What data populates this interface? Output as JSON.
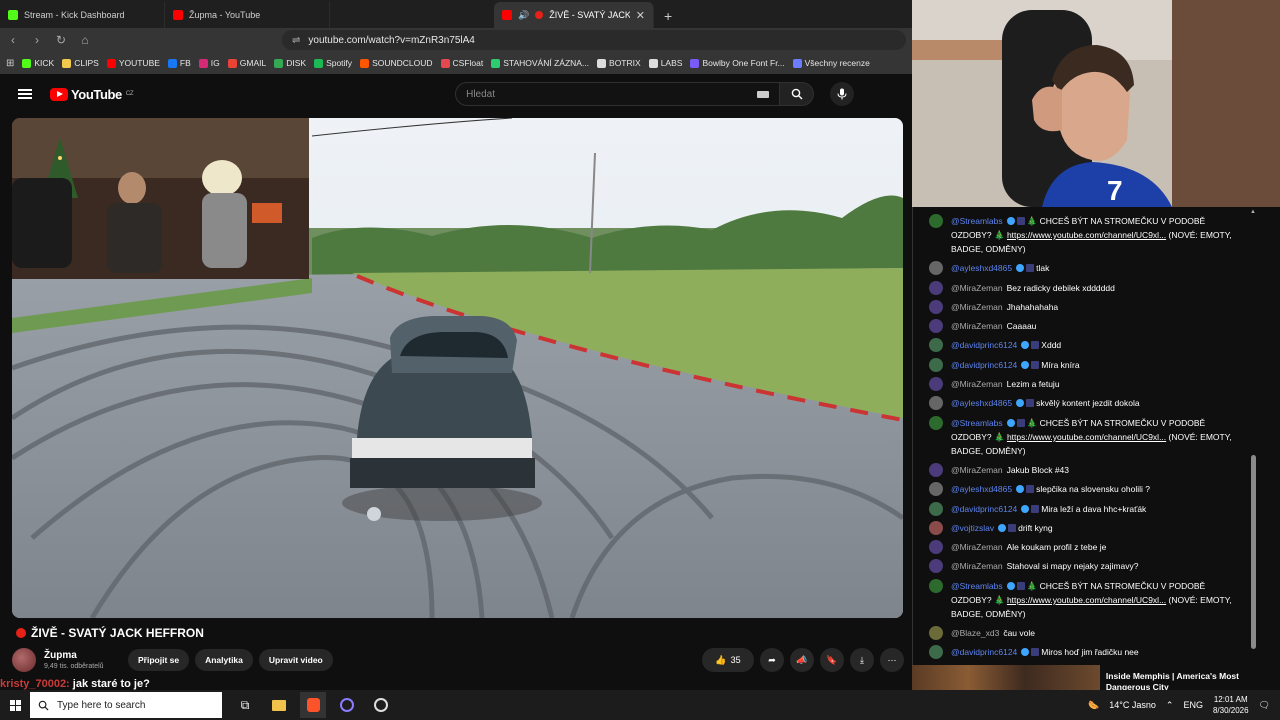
{
  "browser": {
    "tabs": [
      {
        "label": "Stream - Kick Dashboard",
        "color": "#53fc18"
      },
      {
        "label": "Župma - YouTube",
        "color": "#ff0000"
      },
      {
        "label": "ŽIVĚ - SVATÝ JACK HEFFRO",
        "color": "#ff0000"
      }
    ],
    "url": "youtube.com/watch?v=mZnR3n75lA4",
    "bookmarks": [
      {
        "label": "KICK",
        "color": "#53fc18"
      },
      {
        "label": "CLIPS",
        "color": "#f2c94c"
      },
      {
        "label": "YOUTUBE",
        "color": "#ff0000"
      },
      {
        "label": "FB",
        "color": "#1877f2"
      },
      {
        "label": "IG",
        "color": "#d62976"
      },
      {
        "label": "GMAIL",
        "color": "#ea4335"
      },
      {
        "label": "DISK",
        "color": "#34a853"
      },
      {
        "label": "Spotify",
        "color": "#1db954"
      },
      {
        "label": "SOUNDCLOUD",
        "color": "#ff5500"
      },
      {
        "label": "CSFloat",
        "color": "#e5484d"
      },
      {
        "label": "STAHOVÁNÍ ZÁZNA...",
        "color": "#2ecc71"
      },
      {
        "label": "BOTRIX",
        "color": "#dddddd"
      },
      {
        "label": "LABS",
        "color": "#dddddd"
      },
      {
        "label": "Bowlby One Font Fr...",
        "color": "#7a5af8"
      },
      {
        "label": "Všechny recenze",
        "color": "#6b7cff"
      }
    ]
  },
  "youtube": {
    "search_placeholder": "Hledat",
    "video_title": "ŽIVĚ - SVATÝ JACK HEFFRON",
    "channel_name": "Župma",
    "subscribers": "9,49 tis. odběratelů",
    "join_label": "Připojit se",
    "analytics_label": "Analytika",
    "edit_label": "Upravit video",
    "likes": "35",
    "overlay_user": "kristy_70002:",
    "overlay_text": "jak staré to je?"
  },
  "chat": {
    "messages": [
      {
        "user": "@Streamlabs",
        "mod": true,
        "text": "🎄 CHCEŠ BÝT NA STROMEČKU V PODOBĚ OZDOBY? 🎄 ",
        "link": "https://www.youtube.com/channel/UC9xl...",
        "tail": " (NOVÉ: EMOTY, BADGE, ODMĚNY)",
        "avatar": "#2d6a2d"
      },
      {
        "user": "@ayleshxd4865",
        "mod": true,
        "text": "tlak",
        "avatar": "#666"
      },
      {
        "user": "@MiraZeman",
        "mod": false,
        "text": "Bez radicky debilek xdddddd",
        "avatar": "#4b3b7a"
      },
      {
        "user": "@MiraZeman",
        "mod": false,
        "text": "Jhahahahaha",
        "avatar": "#4b3b7a"
      },
      {
        "user": "@MiraZeman",
        "mod": false,
        "text": "Caaaau",
        "avatar": "#4b3b7a"
      },
      {
        "user": "@davidprinc6124",
        "mod": true,
        "text": "Xddd",
        "avatar": "#3d6b4a"
      },
      {
        "user": "@davidprinc6124",
        "mod": true,
        "text": "Míra kníra",
        "avatar": "#3d6b4a"
      },
      {
        "user": "@MiraZeman",
        "mod": false,
        "text": "Lezim a fetuju",
        "avatar": "#4b3b7a"
      },
      {
        "user": "@ayleshxd4865",
        "mod": true,
        "text": "skvělý kontent jezdit dokola",
        "avatar": "#666"
      },
      {
        "user": "@Streamlabs",
        "mod": true,
        "text": "🎄 CHCEŠ BÝT NA STROMEČKU V PODOBĚ OZDOBY? 🎄 ",
        "link": "https://www.youtube.com/channel/UC9xl...",
        "tail": " (NOVÉ: EMOTY, BADGE, ODMĚNY)",
        "avatar": "#2d6a2d"
      },
      {
        "user": "@MiraZeman",
        "mod": false,
        "text": "Jakub Block #43",
        "avatar": "#4b3b7a"
      },
      {
        "user": "@ayleshxd4865",
        "mod": true,
        "text": "slepčika na slovensku oholili ?",
        "avatar": "#666"
      },
      {
        "user": "@davidprinc6124",
        "mod": true,
        "text": "Mira leží a dava hhc+kraťák",
        "avatar": "#3d6b4a"
      },
      {
        "user": "@vojtizslav",
        "mod": true,
        "text": "drift kyng",
        "avatar": "#8a4b4b"
      },
      {
        "user": "@MiraZeman",
        "mod": false,
        "text": "Ale koukam profil z tebe je",
        "avatar": "#4b3b7a"
      },
      {
        "user": "@MiraZeman",
        "mod": false,
        "text": "Stahoval si mapy nejaky zajimavy?",
        "avatar": "#4b3b7a"
      },
      {
        "user": "@Streamlabs",
        "mod": true,
        "text": "🎄 CHCEŠ BÝT NA STROMEČKU V PODOBĚ OZDOBY? 🎄 ",
        "link": "https://www.youtube.com/channel/UC9xl...",
        "tail": " (NOVÉ: EMOTY, BADGE, ODMĚNY)",
        "avatar": "#2d6a2d"
      },
      {
        "user": "@Blaze_xd3",
        "mod": false,
        "text": "čau vole",
        "avatar": "#6b6b3a"
      },
      {
        "user": "@davidprinc6124",
        "mod": true,
        "text": "Miros hoď jim řadičku nee",
        "avatar": "#3d6b4a"
      }
    ],
    "recommended_title": "Inside Memphis | America's Most Dangerous City"
  },
  "taskbar": {
    "search_placeholder": "Type here to search",
    "weather": "14°C  Jasno",
    "lang": "ENG",
    "time": "12:01 AM",
    "date": "8/30/2026"
  }
}
